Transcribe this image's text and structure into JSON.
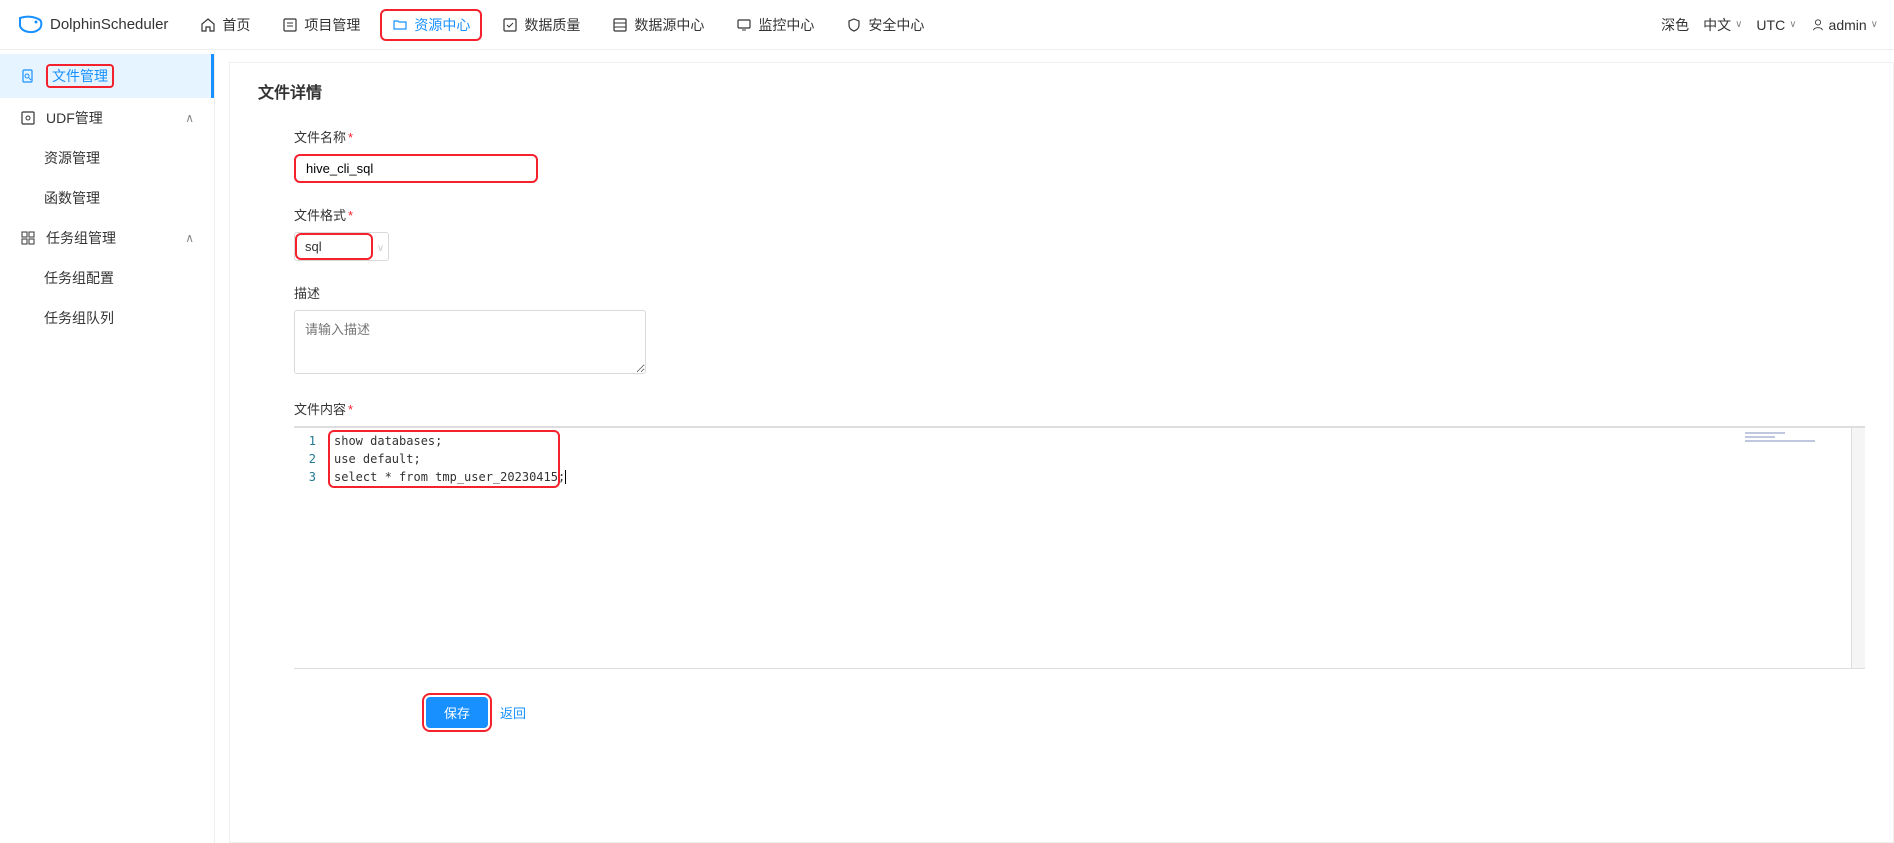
{
  "logo": {
    "text": "DolphinScheduler"
  },
  "nav": {
    "home": "首页",
    "project": "项目管理",
    "resource": "资源中心",
    "data_quality": "数据质量",
    "datasource": "数据源中心",
    "monitor": "监控中心",
    "security": "安全中心"
  },
  "header_right": {
    "theme": "深色",
    "lang": "中文",
    "tz": "UTC",
    "user": "admin"
  },
  "sidebar": {
    "file_mgmt": "文件管理",
    "udf_mgmt": "UDF管理",
    "res_mgmt": "资源管理",
    "func_mgmt": "函数管理",
    "task_group_mgmt": "任务组管理",
    "task_group_cfg": "任务组配置",
    "task_group_queue": "任务组队列"
  },
  "page": {
    "title": "文件详情",
    "labels": {
      "filename": "文件名称",
      "format": "文件格式",
      "desc": "描述",
      "content": "文件内容"
    },
    "filename_value": "hive_cli_sql",
    "format_value": "sql",
    "desc_placeholder": "请输入描述",
    "code_lines": [
      "show databases;",
      "use default;",
      "select * from tmp_user_20230415;"
    ],
    "line_numbers": [
      "1",
      "2",
      "3"
    ],
    "save": "保存",
    "back": "返回"
  }
}
